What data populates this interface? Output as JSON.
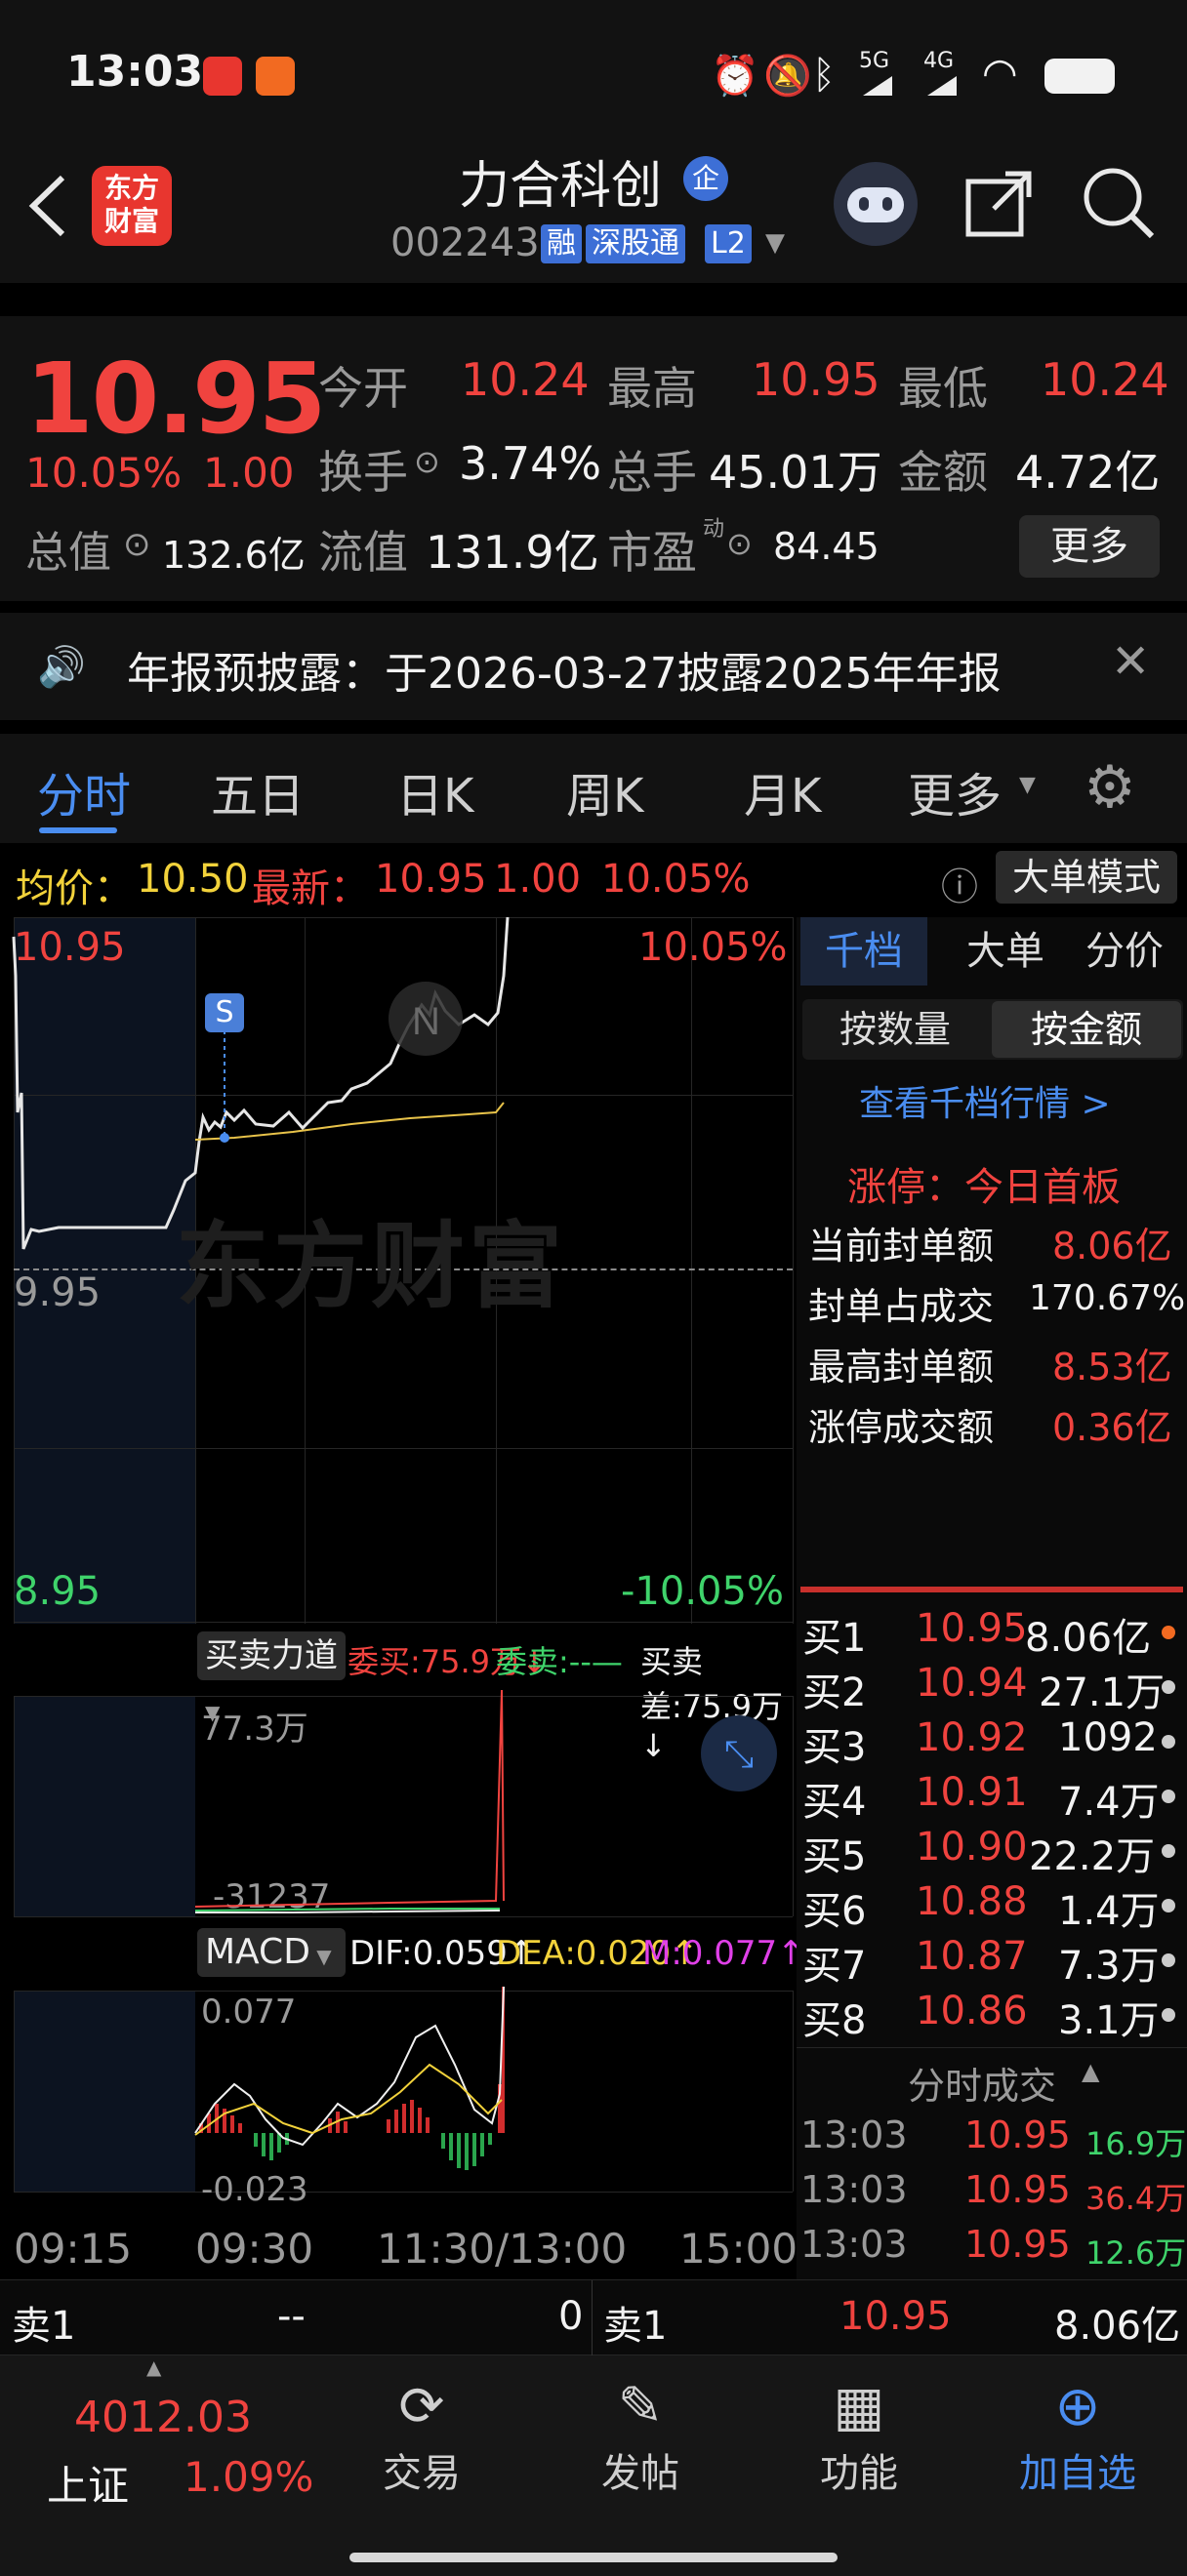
{
  "status_bar": {
    "time": "13:03",
    "network1": "5G",
    "network2": "4G"
  },
  "header": {
    "title": "力合科创",
    "qiye_badge": "企",
    "code": "002243",
    "tags": [
      "融",
      "深股通",
      "L2"
    ],
    "app_logo_line1": "东方",
    "app_logo_line2": "财富"
  },
  "quote": {
    "price": "10.95",
    "pct": "10.05%",
    "change": "1.00",
    "open_label": "今开",
    "open": "10.24",
    "high_label": "最高",
    "high": "10.95",
    "low_label": "最低",
    "low": "10.24",
    "turnover_label": "换手",
    "turnover": "3.74%",
    "volume_label": "总手",
    "volume": "45.01万",
    "amount_label": "金额",
    "amount": "4.72亿",
    "mktcap_label": "总值",
    "mktcap": "132.6亿",
    "float_label": "流值",
    "float": "131.9亿",
    "pe_label": "市盈",
    "pe_sup": "动",
    "pe": "84.45",
    "more_label": "更多"
  },
  "notice": {
    "text": "年报预披露：于2026-03-27披露2025年年报"
  },
  "tabs": [
    "分时",
    "五日",
    "日K",
    "周K",
    "月K",
    "更多"
  ],
  "info_line": {
    "avg_label": "均价：",
    "avg": "10.50",
    "latest_label": "最新：",
    "latest": "10.95",
    "change": "1.00",
    "pct": "10.05%",
    "mode_label": "大单模式"
  },
  "chart": {
    "y_top": "10.95",
    "y_mid": "9.95",
    "y_bottom": "8.95",
    "pct_top": "10.05%",
    "pct_bottom": "-10.05%",
    "marker_s": "S",
    "watermark": "东方财富",
    "x_labels": [
      "09:15",
      "09:30",
      "11:30/13:00",
      "15:00"
    ]
  },
  "force": {
    "selector": "买卖力道",
    "buy_label": "委买:75.9万↓",
    "sell_label": "委卖:--—",
    "diff_label": "买卖差:75.9万↓",
    "y_top": "77.3万",
    "y_bottom": "-31237"
  },
  "macd": {
    "selector": "MACD",
    "dif": "DIF:0.059↑",
    "dea": "DEA:0.020↑",
    "m": "M:0.077↑",
    "y_top": "0.077",
    "y_bottom": "-0.023"
  },
  "right_panel": {
    "tabs": [
      "千档",
      "大单",
      "分价"
    ],
    "mode_tabs": [
      "按数量",
      "按金额"
    ],
    "link": "查看千档行情 >",
    "limit_title": "涨停：今日首板",
    "stats": [
      {
        "label": "当前封单额",
        "value": "8.06亿"
      },
      {
        "label": "封单占成交",
        "value": "170.67%"
      },
      {
        "label": "最高封单额",
        "value": "8.53亿"
      },
      {
        "label": "涨停成交额",
        "value": "0.36亿"
      }
    ],
    "orderbook": [
      {
        "label": "买1",
        "price": "10.95",
        "vol": "8.06亿"
      },
      {
        "label": "买2",
        "price": "10.94",
        "vol": "27.1万"
      },
      {
        "label": "买3",
        "price": "10.92",
        "vol": "1092"
      },
      {
        "label": "买4",
        "price": "10.91",
        "vol": "7.4万"
      },
      {
        "label": "买5",
        "price": "10.90",
        "vol": "22.2万"
      },
      {
        "label": "买6",
        "price": "10.88",
        "vol": "1.4万"
      },
      {
        "label": "买7",
        "price": "10.87",
        "vol": "7.3万"
      },
      {
        "label": "买8",
        "price": "10.86",
        "vol": "3.1万"
      }
    ],
    "trades_title": "分时成交",
    "trades": [
      {
        "time": "13:03",
        "price": "10.95",
        "vol": "16.9万"
      },
      {
        "time": "13:03",
        "price": "10.95",
        "vol": "36.4万"
      },
      {
        "time": "13:03",
        "price": "10.95",
        "vol": "12.6万"
      }
    ]
  },
  "bottom_strip": {
    "left_label": "卖1",
    "left_price": "--",
    "left_vol": "0",
    "right_label": "卖1",
    "right_price": "10.95",
    "right_vol": "8.06亿"
  },
  "bottom_nav": {
    "index_value": "4012.03",
    "index_name": "上证",
    "index_pct": "1.09%",
    "items": [
      "交易",
      "发帖",
      "功能",
      "加自选"
    ]
  }
}
